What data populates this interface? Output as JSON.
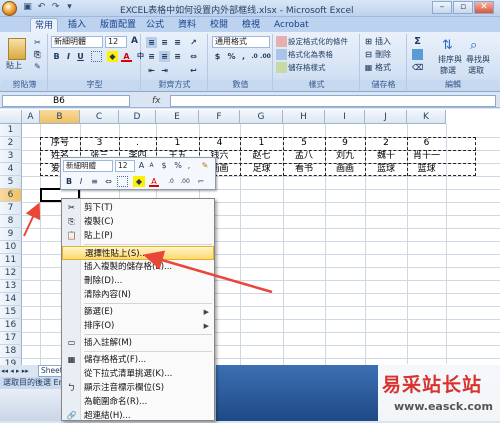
{
  "window": {
    "title": "EXCEL表格中如何设置内外部框线.xlsx - Microsoft Excel",
    "min": "–",
    "max": "▫",
    "close": "✕"
  },
  "tabs": [
    "常用",
    "插入",
    "版面配置",
    "公式",
    "資料",
    "校閱",
    "檢視",
    "Acrobat"
  ],
  "ribbon": {
    "clipboard": {
      "label": "剪貼簿",
      "paste": "貼上"
    },
    "font": {
      "label": "字型",
      "font_name": "新細明體",
      "font_size": "12",
      "grow": "A",
      "shrink": "A",
      "bold": "B",
      "italic": "I",
      "underline": "U",
      "font_color": "A",
      "special": "中"
    },
    "alignment": {
      "label": "對齊方式"
    },
    "number": {
      "label": "數值",
      "format": "通用格式",
      "currency": "$",
      "percent": "%",
      "comma": ",",
      "inc": ".0",
      "dec": ".00"
    },
    "styles": {
      "label": "樣式",
      "cond": "設定格式化的條件",
      "table": "格式化為表格",
      "cell": "儲存格樣式"
    },
    "cells": {
      "label": "儲存格",
      "insert": "插入",
      "delete": "刪除",
      "format": "格式"
    },
    "editing": {
      "label": "編輯",
      "sum": "Σ",
      "sort": "排序與",
      "sort2": "篩選",
      "find": "尋找與",
      "find2": "選取"
    }
  },
  "formula_bar": {
    "name_box": "B6",
    "fx": "fx",
    "formula": ""
  },
  "columns": [
    "A",
    "B",
    "C",
    "D",
    "E",
    "F",
    "G",
    "H",
    "I",
    "J",
    "K"
  ],
  "rows": [
    "1",
    "2",
    "3",
    "4",
    "5",
    "6",
    "7",
    "8",
    "9",
    "10",
    "11",
    "12",
    "13",
    "14",
    "15",
    "16",
    "17",
    "18",
    "19"
  ],
  "table": {
    "r2": [
      "序号",
      "3",
      ".",
      "1",
      "4",
      "1",
      "5",
      "9",
      "2",
      "6"
    ],
    "r3": [
      "姓名",
      "张三",
      "李四",
      "王五",
      "钱六",
      "赵七",
      "孟八",
      "刘九",
      "魏十",
      "肖十一"
    ],
    "r4": [
      "爱好",
      "",
      "",
      "",
      "画画",
      "足球",
      "看书",
      "画画",
      "篮球",
      "篮球"
    ]
  },
  "mini_toolbar": {
    "font": "新細明體",
    "size": "12",
    "grow": "A",
    "shrink": "A",
    "currency": "$",
    "percent": "%",
    "comma": ",",
    "bold": "B",
    "italic": "I",
    "font_color": "A"
  },
  "context_menu": [
    {
      "label": "剪下(T)",
      "icon": "scissors-icon",
      "glyph": "✂"
    },
    {
      "label": "複製(C)",
      "icon": "copy-icon",
      "glyph": "⎘"
    },
    {
      "label": "貼上(P)",
      "icon": "paste-icon",
      "glyph": "📋"
    },
    {
      "label": "選擇性貼上(S)...",
      "icon": "",
      "glyph": ""
    },
    {
      "label": "插入複製的儲存格(E)...",
      "icon": "",
      "glyph": ""
    },
    {
      "label": "刪除(D)...",
      "icon": "",
      "glyph": ""
    },
    {
      "label": "清除內容(N)",
      "icon": "",
      "glyph": ""
    },
    {
      "label": "篩選(E)",
      "icon": "",
      "glyph": "",
      "submenu": true
    },
    {
      "label": "排序(O)",
      "icon": "",
      "glyph": "",
      "submenu": true
    },
    {
      "label": "插入註解(M)",
      "icon": "comment-icon",
      "glyph": "▭"
    },
    {
      "label": "儲存格格式(F)...",
      "icon": "format-cells-icon",
      "glyph": "▦"
    },
    {
      "label": "從下拉式清單挑選(K)...",
      "icon": "",
      "glyph": ""
    },
    {
      "label": "顯示注音標示欄位(S)",
      "icon": "phonetic-icon",
      "glyph": "ㄅ"
    },
    {
      "label": "為範圍命名(R)...",
      "icon": "",
      "glyph": ""
    },
    {
      "label": "超連結(H)...",
      "icon": "hyperlink-icon",
      "glyph": "🔗"
    }
  ],
  "sheet_tab": "Sheet1",
  "status": "選取目的後選 Ent",
  "watermark": {
    "title": "易采站长站",
    "url": "www.easck.com"
  },
  "colors": {
    "highlight": "#ffd86b",
    "arrow": "#e8473a",
    "ribbon": "#dbe5f1"
  }
}
